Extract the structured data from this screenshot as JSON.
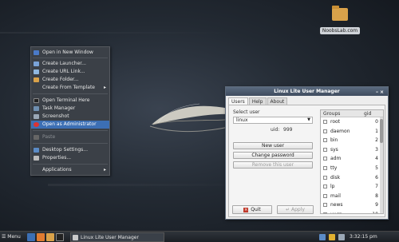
{
  "desktop": {
    "icon_label": "NoobsLab.com"
  },
  "context_menu": {
    "items": [
      {
        "label": "Open in New Window"
      },
      {
        "label": "Create Launcher..."
      },
      {
        "label": "Create URL Link..."
      },
      {
        "label": "Create Folder..."
      },
      {
        "label": "Create From Template"
      },
      {
        "label": "Open Terminal Here"
      },
      {
        "label": "Task Manager"
      },
      {
        "label": "Screenshot"
      },
      {
        "label": "Open as Administrator"
      },
      {
        "label": "Paste"
      },
      {
        "label": "Desktop Settings..."
      },
      {
        "label": "Properties..."
      },
      {
        "label": "Applications"
      }
    ],
    "submenu_arrow": "▸"
  },
  "user_manager": {
    "title": "Linux Lite User Manager",
    "tabs": [
      "Users",
      "Help",
      "About"
    ],
    "select_user_label": "Select user",
    "selected_user": "linux",
    "uid_label": "uid:",
    "uid_value": "999",
    "buttons": {
      "new_user": "New user",
      "change_password": "Change password",
      "remove_user": "Remove this user",
      "quit": "Quit",
      "apply": "Apply"
    },
    "groups_header": {
      "name": "Groups",
      "gid": "gid"
    },
    "groups": [
      {
        "name": "root",
        "gid": "0"
      },
      {
        "name": "daemon",
        "gid": "1"
      },
      {
        "name": "bin",
        "gid": "2"
      },
      {
        "name": "sys",
        "gid": "3"
      },
      {
        "name": "adm",
        "gid": "4"
      },
      {
        "name": "tty",
        "gid": "5"
      },
      {
        "name": "disk",
        "gid": "6"
      },
      {
        "name": "lp",
        "gid": "7"
      },
      {
        "name": "mail",
        "gid": "8"
      },
      {
        "name": "news",
        "gid": "9"
      },
      {
        "name": "uucp",
        "gid": "10"
      }
    ]
  },
  "taskbar": {
    "menu_label": "Menu",
    "task_label": "Linux Lite User Manager",
    "clock": "3:32:15 pm"
  },
  "colors": {
    "menu_highlight": "#3c6fb4",
    "titlebar": "#4b5a6d",
    "folder": "#d9a24a"
  }
}
